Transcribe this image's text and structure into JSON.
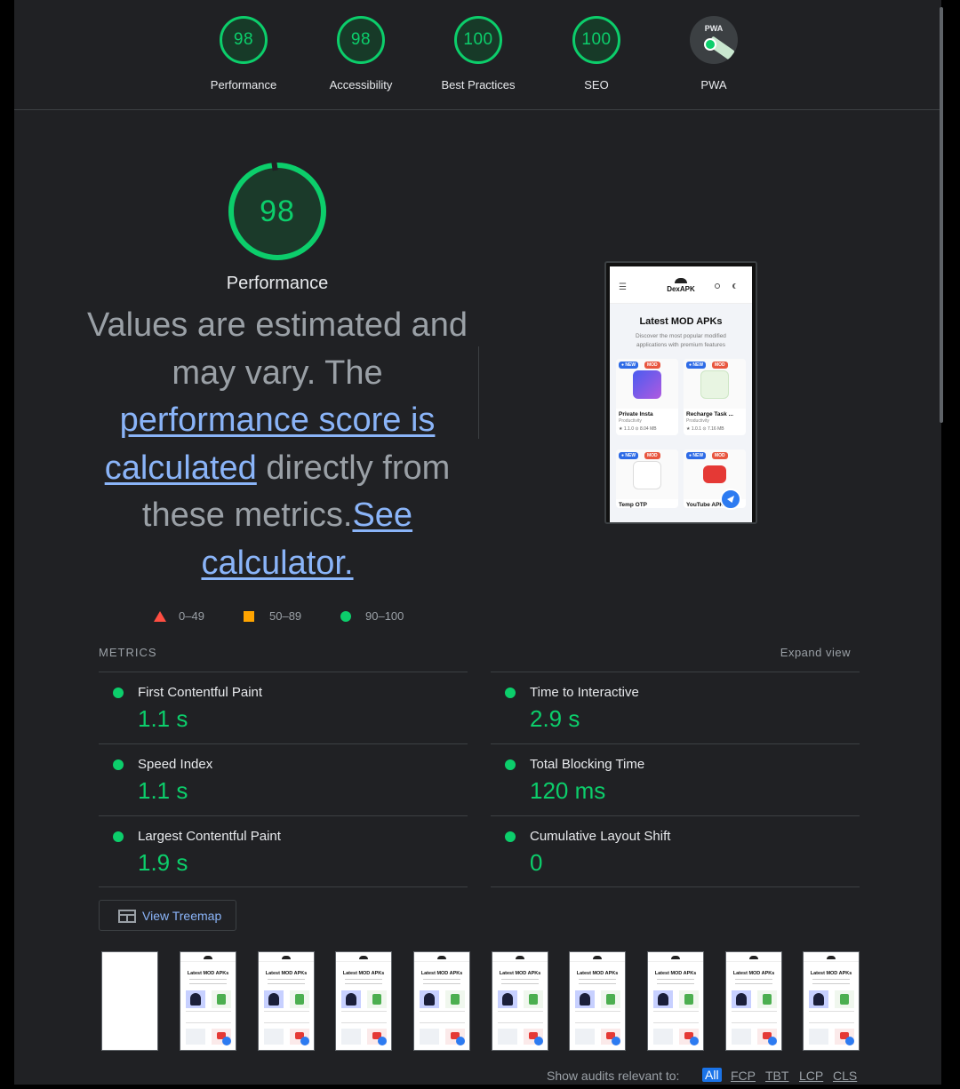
{
  "categories": [
    {
      "score": "98",
      "label": "Performance"
    },
    {
      "score": "98",
      "label": "Accessibility"
    },
    {
      "score": "100",
      "label": "Best Practices"
    },
    {
      "score": "100",
      "label": "SEO"
    },
    {
      "score": "",
      "label": "PWA",
      "badge": "PWA"
    }
  ],
  "performance": {
    "score": "98",
    "title": "Performance",
    "desc_part1": "Values are estimated and may vary. The ",
    "desc_link1": "performance score is calculated",
    "desc_part2": " directly from these metrics.",
    "desc_link2": "See calculator."
  },
  "legend": {
    "fail": "0–49",
    "average": "50–89",
    "pass": "90–100"
  },
  "metrics": {
    "heading": "METRICS",
    "expand_label": "Expand view",
    "left": [
      {
        "name": "First Contentful Paint",
        "value": "1.1 s"
      },
      {
        "name": "Speed Index",
        "value": "1.1 s"
      },
      {
        "name": "Largest Contentful Paint",
        "value": "1.9 s"
      }
    ],
    "right": [
      {
        "name": "Time to Interactive",
        "value": "2.9 s"
      },
      {
        "name": "Total Blocking Time",
        "value": "120 ms"
      },
      {
        "name": "Cumulative Layout Shift",
        "value": "0"
      }
    ]
  },
  "treemap_label": "View Treemap",
  "screenshot": {
    "site_name": "DexAPK",
    "heading": "Latest MOD APKs",
    "subheading": "Discover the most popular modified applications with premium features",
    "tag_new": "● NEW",
    "tag_mod": "MOD",
    "apps": [
      {
        "name": "Private Insta",
        "category": "Productivity",
        "meta": "★ 1.1.0   ⊙ 8.04 MB"
      },
      {
        "name": "Recharge Task ...",
        "category": "Productivity",
        "meta": "★ 1.0.1   ⊙ 7.16 MB"
      },
      {
        "name": "Temp OTP",
        "category": "",
        "meta": ""
      },
      {
        "name": "YouTube APK",
        "category": "",
        "meta": ""
      }
    ]
  },
  "filmstrip_title": "Latest MOD APKs",
  "audits": {
    "label": "Show audits relevant to:",
    "filters": [
      "All",
      "FCP",
      "TBT",
      "LCP",
      "CLS"
    ]
  },
  "colors": {
    "pass": "#0cce6b",
    "average": "#ffa400",
    "fail": "#ff4e42",
    "link": "#8ab4f8",
    "background": "#202124"
  }
}
